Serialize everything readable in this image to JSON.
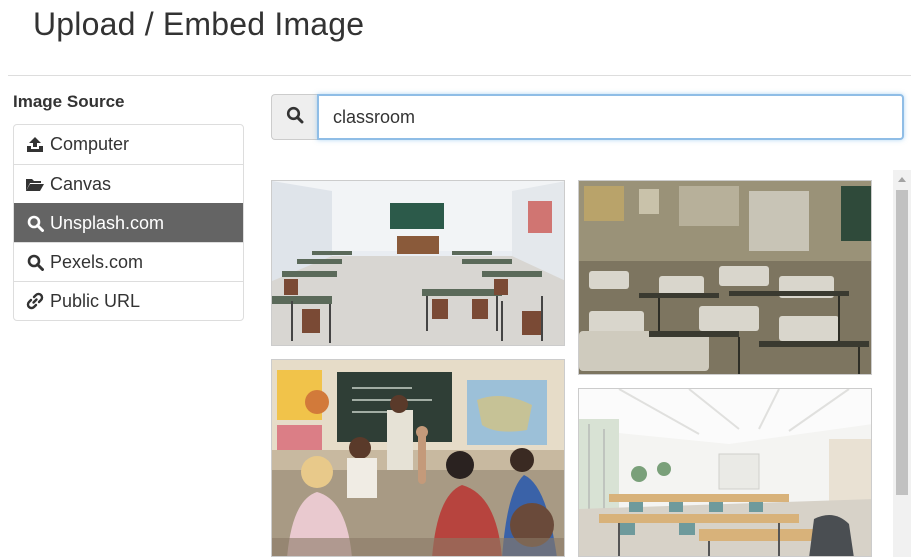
{
  "dialog": {
    "title": "Upload / Embed Image"
  },
  "sidebar": {
    "heading": "Image Source",
    "items": [
      {
        "label": "Computer",
        "icon": "upload-icon",
        "active": false
      },
      {
        "label": "Canvas",
        "icon": "folder-open-icon",
        "active": false
      },
      {
        "label": "Unsplash.com",
        "icon": "search-icon",
        "active": true
      },
      {
        "label": "Pexels.com",
        "icon": "search-icon",
        "active": false
      },
      {
        "label": "Public URL",
        "icon": "link-icon",
        "active": false
      }
    ]
  },
  "search": {
    "value": "classroom",
    "button_icon": "search-icon"
  },
  "results": [
    {
      "alt": "classroom photo 1"
    },
    {
      "alt": "classroom photo 2"
    },
    {
      "alt": "classroom photo 3"
    },
    {
      "alt": "classroom photo 4"
    }
  ],
  "colors": {
    "active_bg": "#646464",
    "focus_border": "#8fbde6"
  }
}
